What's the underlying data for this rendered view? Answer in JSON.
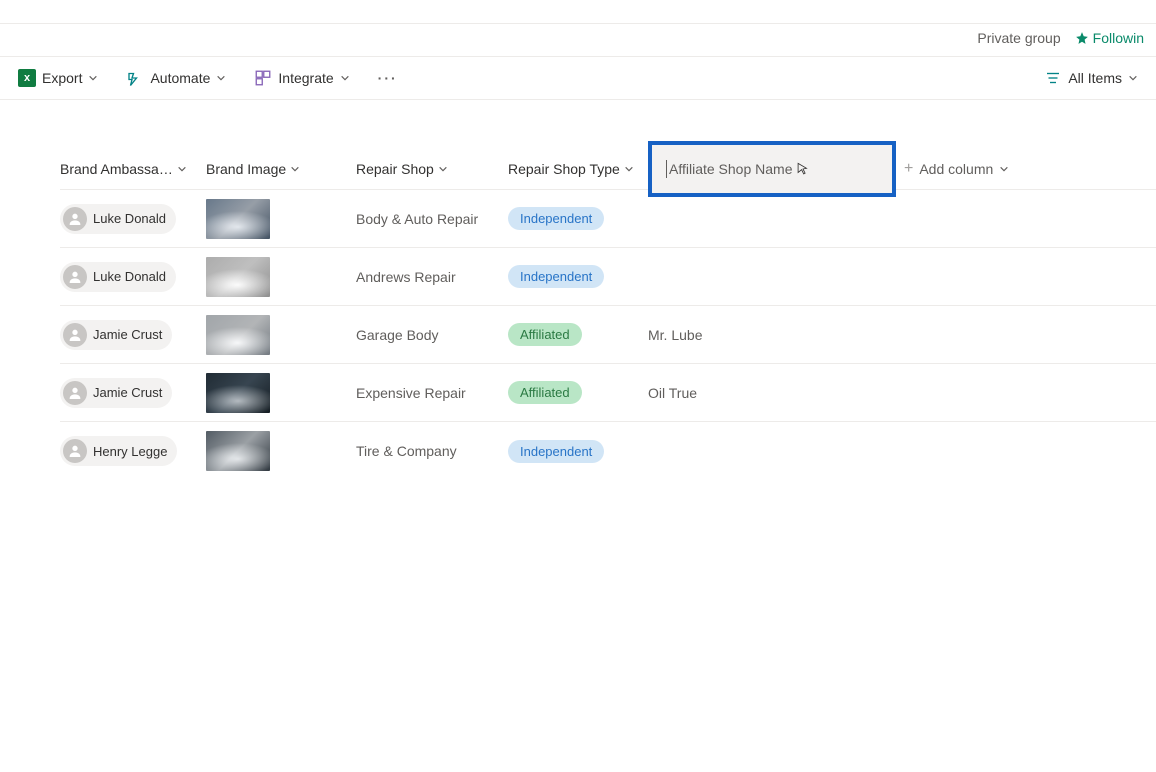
{
  "header": {
    "private_group": "Private group",
    "following": "Followin"
  },
  "toolbar": {
    "export": "Export",
    "automate": "Automate",
    "integrate": "Integrate",
    "all_items": "All Items"
  },
  "columns": {
    "ambassador": "Brand Ambassa…",
    "image": "Brand Image",
    "repair_shop": "Repair Shop",
    "repair_type": "Repair Shop Type",
    "affiliate": "Affiliate Shop Name",
    "add": "Add column"
  },
  "rows": [
    {
      "ambassador": "Luke Donald",
      "img_class": "bi-1",
      "repair_shop": "Body & Auto Repair",
      "repair_type": "Independent",
      "repair_type_class": "pill-independent",
      "affiliate": ""
    },
    {
      "ambassador": "Luke Donald",
      "img_class": "bi-2",
      "repair_shop": "Andrews Repair",
      "repair_type": "Independent",
      "repair_type_class": "pill-independent",
      "affiliate": ""
    },
    {
      "ambassador": "Jamie Crust",
      "img_class": "bi-3",
      "repair_shop": "Garage Body",
      "repair_type": "Affiliated",
      "repair_type_class": "pill-affiliated",
      "affiliate": "Mr. Lube"
    },
    {
      "ambassador": "Jamie Crust",
      "img_class": "bi-4",
      "repair_shop": "Expensive Repair",
      "repair_type": "Affiliated",
      "repair_type_class": "pill-affiliated",
      "affiliate": "Oil True"
    },
    {
      "ambassador": "Henry Legge",
      "img_class": "bi-5",
      "repair_shop": "Tire & Company",
      "repair_type": "Independent",
      "repair_type_class": "pill-independent",
      "affiliate": ""
    }
  ]
}
